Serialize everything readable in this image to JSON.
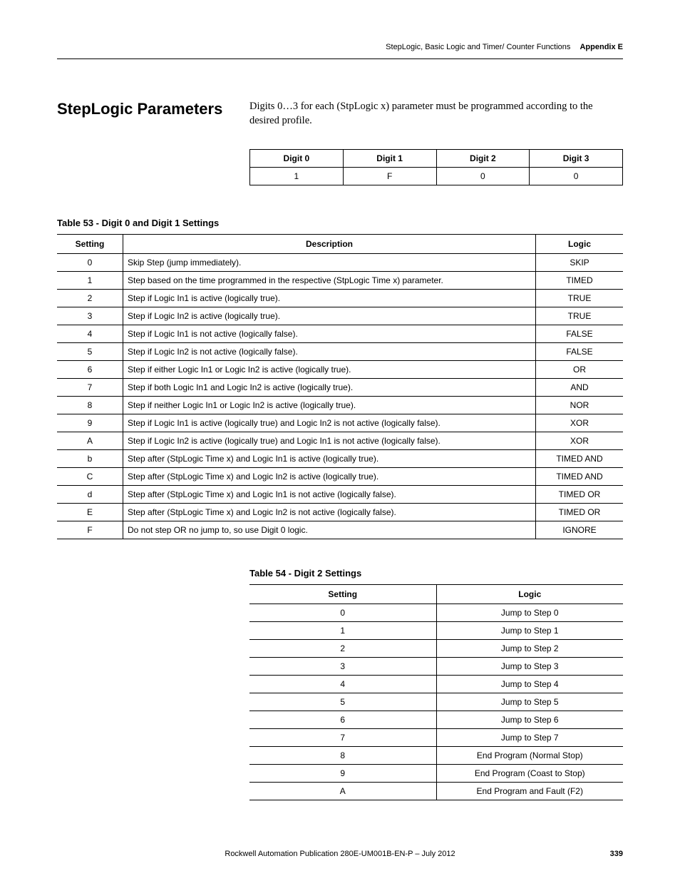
{
  "header": {
    "breadcrumb": "StepLogic, Basic Logic and Timer/ Counter Functions",
    "appendix": "Appendix E"
  },
  "section": {
    "title": "StepLogic Parameters",
    "body": "Digits 0…3 for each (StpLogic x) parameter must be programmed according to the desired profile."
  },
  "digit_table": {
    "headers": [
      "Digit 0",
      "Digit 1",
      "Digit 2",
      "Digit 3"
    ],
    "values": [
      "1",
      "F",
      "0",
      "0"
    ]
  },
  "table53": {
    "caption": "Table 53 - Digit 0 and Digit 1 Settings",
    "headers": {
      "setting": "Setting",
      "description": "Description",
      "logic": "Logic"
    },
    "rows": [
      {
        "s": "0",
        "d": "Skip Step (jump immediately).",
        "l": "SKIP"
      },
      {
        "s": "1",
        "d": "Step based on the time programmed in the respective (StpLogic Time x) parameter.",
        "l": "TIMED"
      },
      {
        "s": "2",
        "d": "Step if Logic In1 is active (logically true).",
        "l": "TRUE"
      },
      {
        "s": "3",
        "d": "Step if Logic In2 is active (logically true).",
        "l": "TRUE"
      },
      {
        "s": "4",
        "d": "Step if Logic In1 is not active (logically false).",
        "l": "FALSE"
      },
      {
        "s": "5",
        "d": "Step if Logic In2 is not active (logically false).",
        "l": "FALSE"
      },
      {
        "s": "6",
        "d": "Step if either Logic In1 or Logic In2 is active (logically true).",
        "l": "OR"
      },
      {
        "s": "7",
        "d": "Step if both Logic In1 and Logic In2 is active (logically true).",
        "l": "AND"
      },
      {
        "s": "8",
        "d": "Step if neither Logic In1 or Logic In2 is active (logically true).",
        "l": "NOR"
      },
      {
        "s": "9",
        "d": "Step if Logic In1 is active (logically true) and Logic In2 is not active (logically false).",
        "l": "XOR"
      },
      {
        "s": "A",
        "d": "Step if Logic In2 is active (logically true) and Logic In1 is not active (logically false).",
        "l": "XOR"
      },
      {
        "s": "b",
        "d": "Step after (StpLogic Time x) and Logic In1 is active (logically true).",
        "l": "TIMED AND"
      },
      {
        "s": "C",
        "d": "Step after (StpLogic Time x) and Logic In2 is active (logically true).",
        "l": "TIMED AND"
      },
      {
        "s": "d",
        "d": "Step after (StpLogic Time x) and Logic In1 is not active (logically false).",
        "l": "TIMED OR"
      },
      {
        "s": "E",
        "d": "Step after (StpLogic Time x) and Logic In2 is not active (logically false).",
        "l": "TIMED OR"
      },
      {
        "s": "F",
        "d": "Do not step OR no jump to, so use Digit 0 logic.",
        "l": "IGNORE"
      }
    ]
  },
  "table54": {
    "caption": "Table 54 - Digit 2 Settings",
    "headers": {
      "setting": "Setting",
      "logic": "Logic"
    },
    "rows": [
      {
        "s": "0",
        "l": "Jump to Step 0"
      },
      {
        "s": "1",
        "l": "Jump to Step 1"
      },
      {
        "s": "2",
        "l": "Jump to Step 2"
      },
      {
        "s": "3",
        "l": "Jump to Step 3"
      },
      {
        "s": "4",
        "l": "Jump to Step 4"
      },
      {
        "s": "5",
        "l": "Jump to Step 5"
      },
      {
        "s": "6",
        "l": "Jump to Step 6"
      },
      {
        "s": "7",
        "l": "Jump to Step 7"
      },
      {
        "s": "8",
        "l": "End Program (Normal Stop)"
      },
      {
        "s": "9",
        "l": "End Program (Coast to Stop)"
      },
      {
        "s": "A",
        "l": "End Program and Fault (F2)"
      }
    ]
  },
  "footer": {
    "publication": "Rockwell Automation Publication 280E-UM001B-EN-P – July 2012",
    "page": "339"
  }
}
